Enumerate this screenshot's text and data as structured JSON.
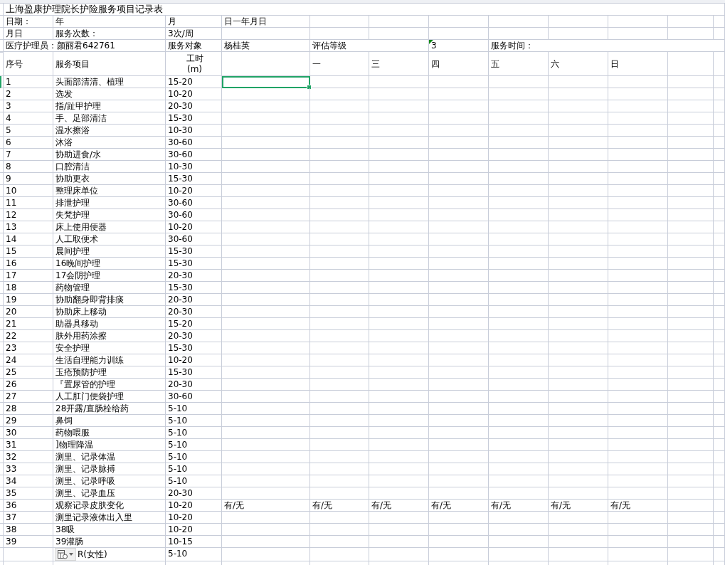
{
  "title": "上海盈康护理院长护险服务项目记录表",
  "date_row": {
    "label": "日期：",
    "year": "年",
    "month": "月",
    "day": "日一年月日"
  },
  "frequency_row": {
    "label": "月日",
    "field": "服务次数：",
    "value": "3次/周"
  },
  "staff_row": {
    "nurse": "医疗护理员：颜丽君642761",
    "subject_label": "服务对象",
    "subject": "杨桂英",
    "grade_label": "评估等级",
    "grade": "3",
    "time_label": "服务时间："
  },
  "header": {
    "seq": "序号",
    "item": "服务项目",
    "hours": [
      "工时",
      "(m)"
    ],
    "days": [
      "一",
      "三",
      "四",
      "五",
      "六",
      "日"
    ]
  },
  "rows": [
    {
      "seq": "1",
      "item": "头面部清清、植理",
      "hours": "15-20",
      "selected": true
    },
    {
      "seq": "2",
      "item": "选发",
      "hours": "10-20",
      "selected": false
    },
    {
      "seq": "3",
      "item": "指/趾甲护理",
      "hours": "20-30",
      "selected": false
    },
    {
      "seq": "4",
      "item": "手、足部清洁",
      "hours": "15-30",
      "selected": false
    },
    {
      "seq": "5",
      "item": "温水擦浴",
      "hours": "10-30",
      "selected": false
    },
    {
      "seq": "6",
      "item": "沐浴",
      "hours": "30-60",
      "selected": false
    },
    {
      "seq": "7",
      "item": "协助进食/水",
      "hours": "30-60",
      "selected": false
    },
    {
      "seq": "8",
      "item": "口腔清洁",
      "hours": "10-30",
      "selected": false
    },
    {
      "seq": "9",
      "item": "协助更衣",
      "hours": "15-30",
      "selected": false
    },
    {
      "seq": "10",
      "item": "整理床单位",
      "hours": "10-20",
      "selected": false
    },
    {
      "seq": "11",
      "item": "排泄护理",
      "hours": "30-60",
      "selected": false
    },
    {
      "seq": "12",
      "item": "失梵护理",
      "hours": "30-60",
      "selected": false
    },
    {
      "seq": "13",
      "item": "床上使用便器",
      "hours": "10-20",
      "selected": false
    },
    {
      "seq": "14",
      "item": "人工取便术",
      "hours": "30-60",
      "selected": false
    },
    {
      "seq": "15",
      "item": "晨间护理",
      "hours": "15-30",
      "selected": false
    },
    {
      "seq": "16",
      "item": "16晚间护理",
      "hours": "15-30",
      "selected": false
    },
    {
      "seq": "17",
      "item": "17会阴护理",
      "hours": "20-30",
      "selected": false
    },
    {
      "seq": "18",
      "item": "药物管理",
      "hours": "15-30",
      "selected": false
    },
    {
      "seq": "19",
      "item": "协助翻身即背排痰",
      "hours": "20-30",
      "selected": false
    },
    {
      "seq": "20",
      "item": "协助床上移动",
      "hours": "20-30",
      "selected": false
    },
    {
      "seq": "21",
      "item": "助器具移动",
      "hours": "15-20",
      "selected": false
    },
    {
      "seq": "22",
      "item": "肤外用药涂擦",
      "hours": "20-30",
      "selected": false
    },
    {
      "seq": "23",
      "item": "安全护理",
      "hours": "15-30",
      "selected": false
    },
    {
      "seq": "24",
      "item": "生活自理能力训练",
      "hours": "10-20",
      "selected": false
    },
    {
      "seq": "25",
      "item": "玉疮预防护理",
      "hours": "15-30",
      "selected": false
    },
    {
      "seq": "26",
      "item": "『置尿管的护理",
      "hours": "20-30",
      "selected": false
    },
    {
      "seq": "27",
      "item": "人工肛门便袋护理",
      "hours": "30-60",
      "selected": false
    },
    {
      "seq": "28",
      "item": "28开露/直肠栓给药",
      "hours": "5-10",
      "selected": false
    },
    {
      "seq": "29",
      "item": "鼻饲",
      "hours": "5-10",
      "selected": false
    },
    {
      "seq": "30",
      "item": "药物喂服",
      "hours": "5-10",
      "selected": false
    },
    {
      "seq": "31",
      "item": "]物理降温",
      "hours": "5-10",
      "selected": false
    },
    {
      "seq": "32",
      "item": "测里、记录体温",
      "hours": "5-10",
      "selected": false
    },
    {
      "seq": "33",
      "item": "测里、记录脉搏",
      "hours": "5-10",
      "selected": false
    },
    {
      "seq": "34",
      "item": "测里、记录呼吸",
      "hours": "5-10",
      "selected": false
    },
    {
      "seq": "35",
      "item": "测里、记录血压",
      "hours": "20-30",
      "selected": false
    },
    {
      "seq": "36",
      "item": "观察记录皮肤变化",
      "hours": "10-20",
      "selected": false,
      "marks": [
        "有/无",
        "有/无",
        "有/无",
        "有/无",
        "有/无",
        "有/无",
        "有/无"
      ]
    },
    {
      "seq": "37",
      "item": "测里记录液体出入里",
      "hours": "10-20",
      "selected": false
    },
    {
      "seq": "38",
      "item": "38吸",
      "hours": "10-20",
      "selected": false
    },
    {
      "seq": "39",
      "item": "39灌肠",
      "hours": "10-15",
      "selected": false
    },
    {
      "item": "R(女性)",
      "hours": "5-10",
      "selected": false,
      "paste_options": true
    }
  ]
}
